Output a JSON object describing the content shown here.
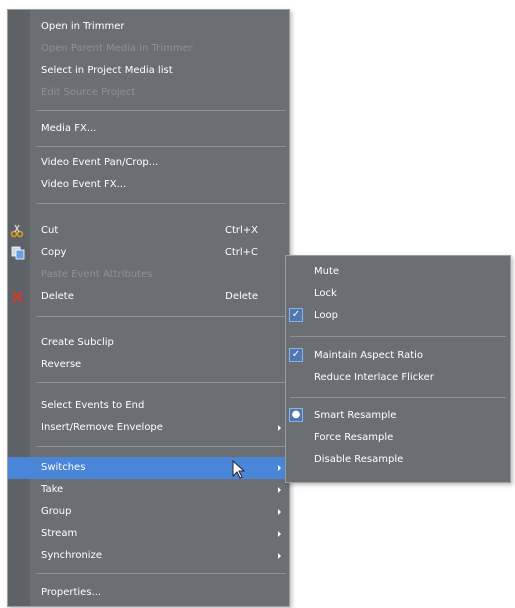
{
  "main_menu": {
    "items": [
      {
        "label": "Open in Trimmer",
        "disabled": false
      },
      {
        "label": "Open Parent Media in Trimmer",
        "disabled": true
      },
      {
        "label": "Select in Project Media list",
        "disabled": false
      },
      {
        "label": "Edit Source Project",
        "disabled": true
      },
      {
        "label": "Media FX...",
        "disabled": false
      },
      {
        "label": "Video Event Pan/Crop...",
        "disabled": false
      },
      {
        "label": "Video Event FX...",
        "disabled": false
      },
      {
        "label": "Cut",
        "shortcut": "Ctrl+X",
        "icon": "scissors-icon",
        "disabled": false
      },
      {
        "label": "Copy",
        "shortcut": "Ctrl+C",
        "icon": "copy-icon",
        "disabled": false
      },
      {
        "label": "Paste Event Attributes",
        "disabled": true
      },
      {
        "label": "Delete",
        "shortcut": "Delete",
        "icon": "delete-x-icon",
        "disabled": false
      },
      {
        "label": "Create Subclip",
        "disabled": false
      },
      {
        "label": "Reverse",
        "disabled": false
      },
      {
        "label": "Select Events to End",
        "disabled": false
      },
      {
        "label": "Insert/Remove Envelope",
        "submenu": true,
        "disabled": false
      },
      {
        "label": "Switches",
        "submenu": true,
        "highlighted": true,
        "disabled": false
      },
      {
        "label": "Take",
        "submenu": true,
        "disabled": false
      },
      {
        "label": "Group",
        "submenu": true,
        "disabled": false
      },
      {
        "label": "Stream",
        "submenu": true,
        "disabled": false
      },
      {
        "label": "Synchronize",
        "submenu": true,
        "disabled": false
      },
      {
        "label": "Properties...",
        "disabled": false
      }
    ]
  },
  "switches_submenu": {
    "items": [
      {
        "label": "Mute",
        "checked": false
      },
      {
        "label": "Lock",
        "checked": false
      },
      {
        "label": "Loop",
        "checked": true
      },
      {
        "label": "Maintain Aspect Ratio",
        "checked": true
      },
      {
        "label": "Reduce Interlace Flicker",
        "checked": false
      },
      {
        "label": "Smart Resample",
        "radio": true
      },
      {
        "label": "Force Resample",
        "checked": false
      },
      {
        "label": "Disable Resample",
        "checked": false
      }
    ]
  },
  "colors": {
    "menu_background": "#6b6f73",
    "highlight": "#4a86d8",
    "text": "#ffffff",
    "disabled_text": "#8d9195"
  }
}
